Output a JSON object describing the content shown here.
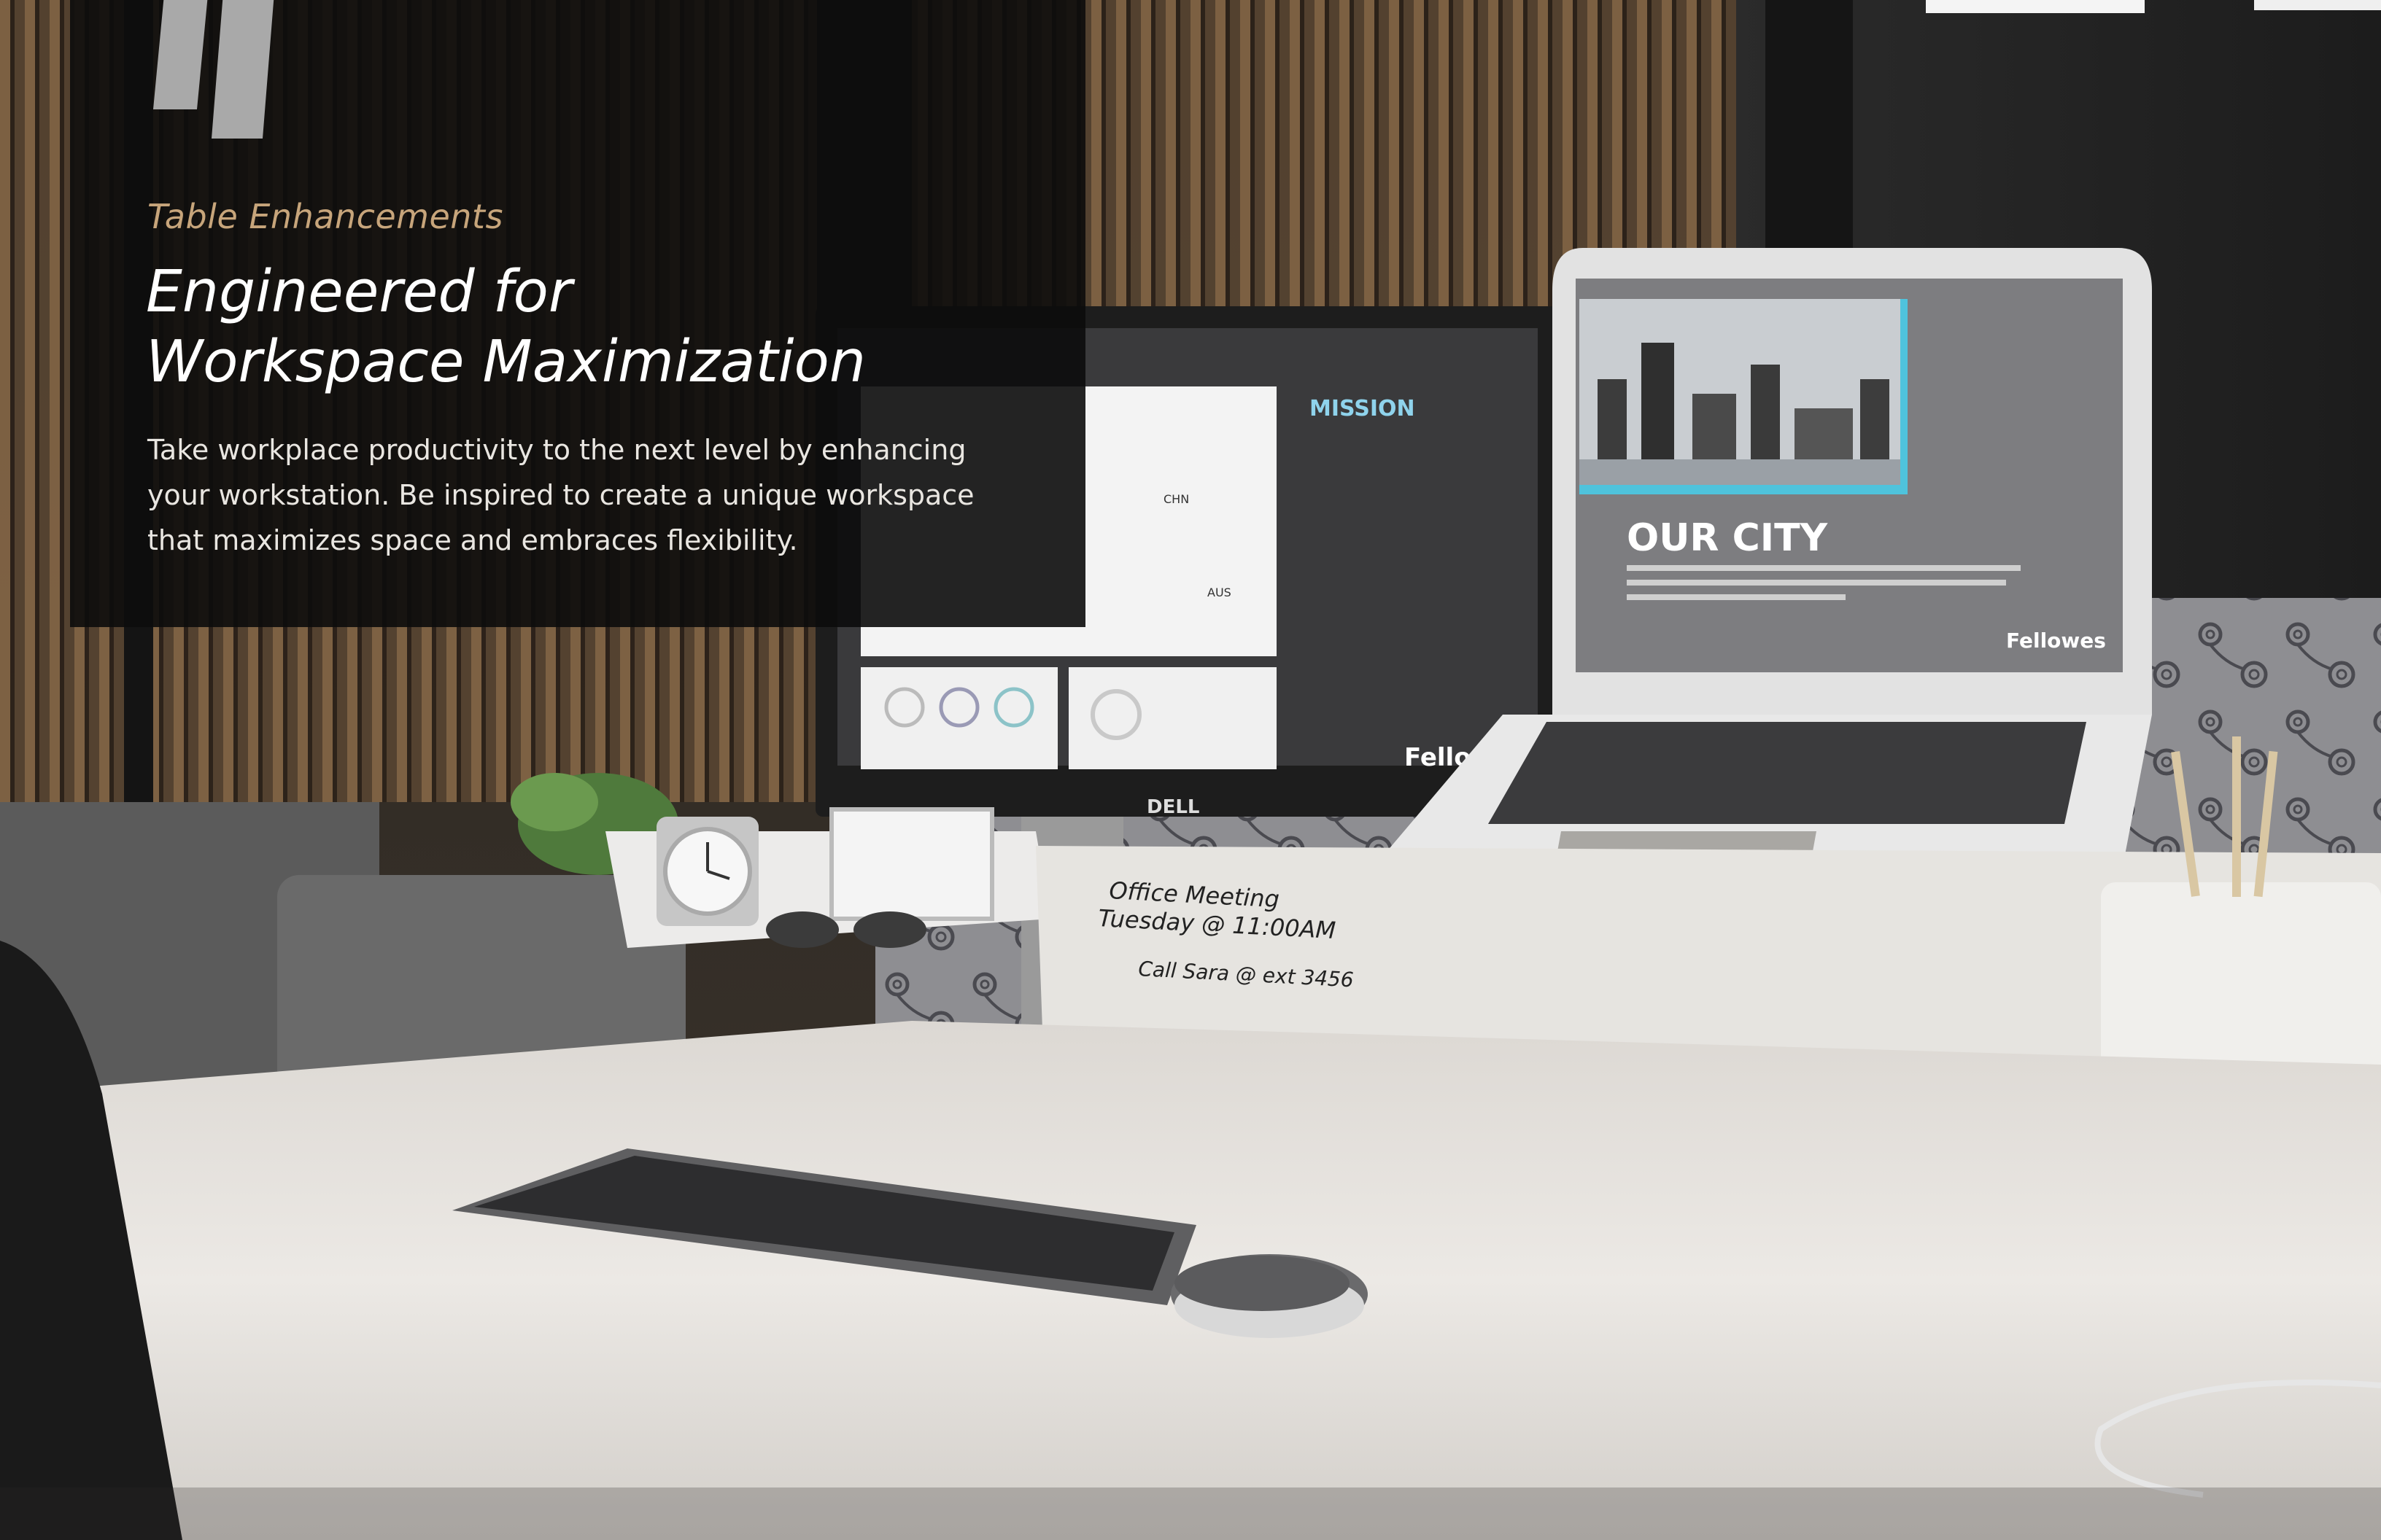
{
  "panel": {
    "eyebrow": "Table Enhancements",
    "headline_line1": "Engineered for",
    "headline_line2": "Workspace Maximization",
    "body": "Take workplace productivity to the next level by enhancing your workstation. Be inspired to create a unique workspace that maximizes space and embraces flexibility."
  },
  "monitor": {
    "brand": "DELL",
    "screen_title": "MISSION",
    "screen_logo": "Fellowes",
    "map_labels": [
      "CHN",
      "AUS"
    ]
  },
  "laptop": {
    "screen_title": "OUR CITY",
    "screen_logo": "Fellowes"
  },
  "whiteboard": {
    "note1_line1": "Office Meeting",
    "note1_line2": "Tuesday @ 11:00AM",
    "note2": "Call Sara @ ext 3456"
  },
  "colors": {
    "panel_bg": "#0c0c0c",
    "eyebrow": "#c7a57b",
    "headline": "#ffffff",
    "body": "#e9e6e1",
    "accent_cyan": "#4fc3dc"
  }
}
